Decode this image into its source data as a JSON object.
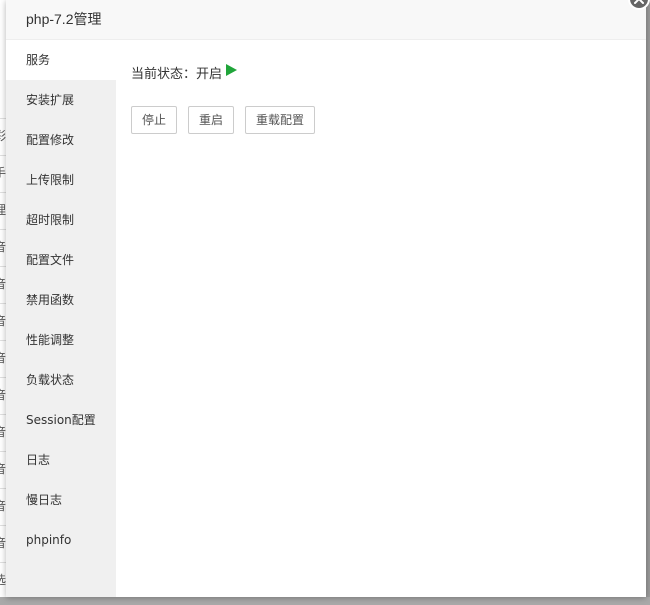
{
  "modal": {
    "title": "php-7.2管理"
  },
  "sidebar": {
    "items": [
      {
        "label": "服务",
        "active": true
      },
      {
        "label": "安装扩展"
      },
      {
        "label": "配置修改"
      },
      {
        "label": "上传限制"
      },
      {
        "label": "超时限制"
      },
      {
        "label": "配置文件"
      },
      {
        "label": "禁用函数"
      },
      {
        "label": "性能调整"
      },
      {
        "label": "负载状态"
      },
      {
        "label": "Session配置"
      },
      {
        "label": "日志"
      },
      {
        "label": "慢日志"
      },
      {
        "label": "phpinfo"
      }
    ]
  },
  "service": {
    "status_text": "当前状态：开启",
    "status_icon": "play-icon",
    "status_color": "#20a53a",
    "buttons": {
      "stop": "停止",
      "restart": "重启",
      "reload": "重载配置"
    }
  },
  "background": {
    "edge_chars": [
      "彩",
      "手",
      "理",
      "音",
      "音",
      "音",
      "音",
      "音",
      "音",
      "音",
      "音",
      "音",
      "选"
    ]
  }
}
